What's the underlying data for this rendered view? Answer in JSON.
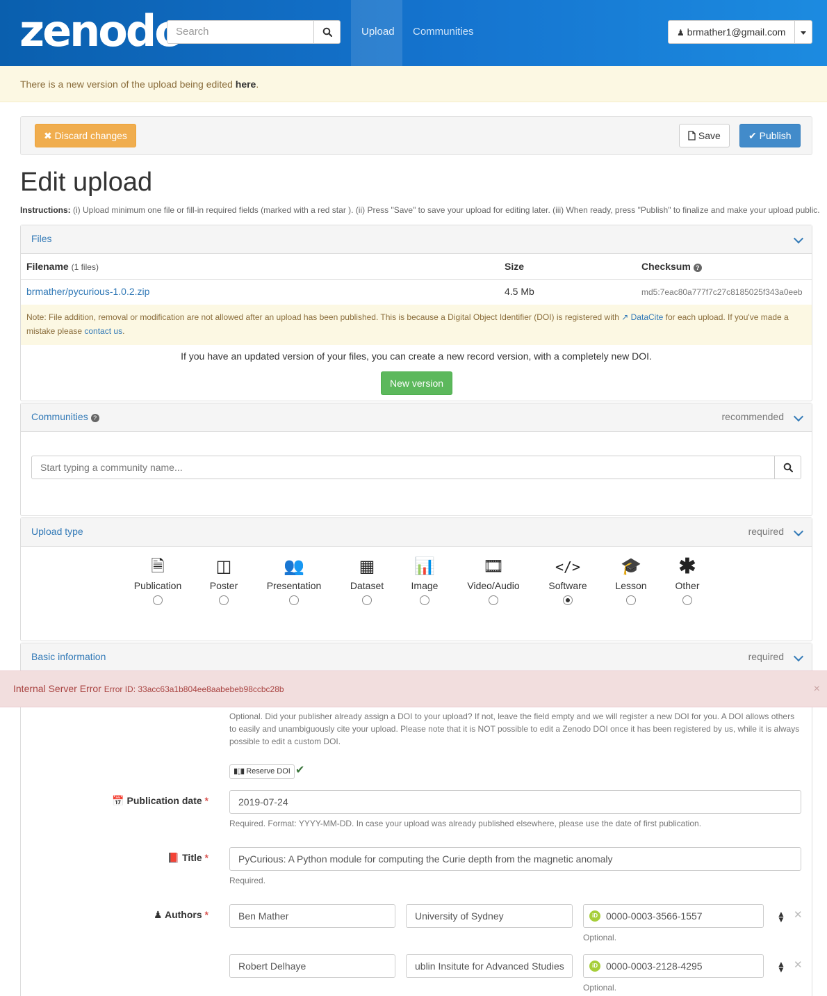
{
  "nav": {
    "logo": "zenodo",
    "search_placeholder": "Search",
    "tabs": [
      "Upload",
      "Communities"
    ],
    "user": "brmather1@gmail.com"
  },
  "version_alert": {
    "text": "There is a new version of the upload being edited ",
    "link": "here",
    "suffix": "."
  },
  "actions": {
    "discard": "Discard changes",
    "save": "Save",
    "publish": "Publish"
  },
  "title": "Edit upload",
  "instructions": {
    "label": "Instructions:",
    "text": " (i) Upload minimum one file or fill-in required fields (marked with a red star ). (ii) Press \"Save\" to save your upload for editing later. (iii) When ready, press \"Publish\" to finalize and make your upload public."
  },
  "files": {
    "heading": "Files",
    "col_filename": "Filename",
    "col_filename_count": "(1 files)",
    "col_size": "Size",
    "col_checksum": "Checksum",
    "file_name": "brmather/pycurious-1.0.2.zip",
    "file_size": "4.5 Mb",
    "file_checksum": "md5:7eac80a777f7c27c8185025f343a0eeb",
    "note_1": "Note: File addition, removal or modification are not allowed after an upload has been published. This is because a Digital Object Identifier (DOI) is registered with ",
    "note_link": "DataCite",
    "note_2": " for each upload. If you've made a mistake please ",
    "note_contact": "contact us",
    "note_end": ".",
    "newver_text": "If you have an updated version of your files, you can create a new record version, with a completely new DOI.",
    "newver_btn": "New version"
  },
  "communities": {
    "heading": "Communities",
    "badge": "recommended",
    "placeholder": "Start typing a community name..."
  },
  "upload_type": {
    "heading": "Upload type",
    "badge": "required",
    "types": [
      "Publication",
      "Poster",
      "Presentation",
      "Dataset",
      "Image",
      "Video/Audio",
      "Software",
      "Lesson",
      "Other"
    ],
    "selected": "Software"
  },
  "basic": {
    "heading": "Basic information",
    "badge": "required"
  },
  "error": {
    "title": "Internal Server Error",
    "id": "Error ID: 33acc63a1b804ee8aabebeb98ccbc28b"
  },
  "doi": {
    "help": "Optional. Did your publisher already assign a DOI to your upload? If not, leave the field empty and we will register a new DOI for you. A DOI allows others to easily and unambiguously cite your upload. Please note that it is NOT possible to edit a Zenodo DOI once it has been registered by us, while it is always possible to edit a custom DOI.",
    "reserve": "Reserve DOI"
  },
  "pubdate": {
    "label": "Publication date",
    "value": "2019-07-24",
    "help": "Required. Format: YYYY-MM-DD. In case your upload was already published elsewhere, please use the date of first publication."
  },
  "title_field": {
    "label": "Title",
    "value": "PyCurious: A Python module for computing the Curie depth from the magnetic anomaly",
    "help": "Required."
  },
  "authors": {
    "label": "Authors",
    "rows": [
      {
        "name": "Ben Mather",
        "affiliation": "University of Sydney",
        "orcid": "0000-0003-3566-1557",
        "help": "Optional."
      },
      {
        "name": "Robert Delhaye",
        "affiliation": "ublin Insitute for Advanced Studies",
        "orcid": "0000-0003-2128-4295",
        "help": "Optional."
      }
    ]
  }
}
